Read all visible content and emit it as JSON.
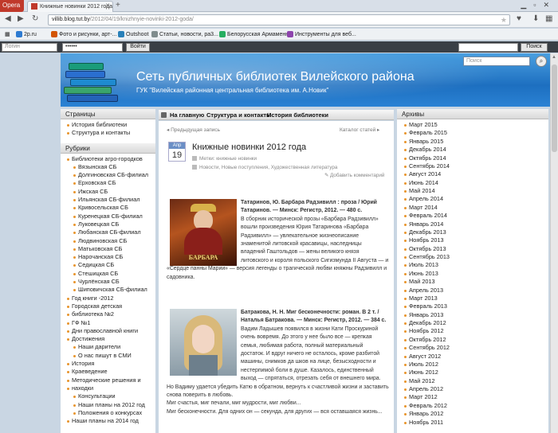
{
  "browser": {
    "app": "Opera",
    "tab_title": "Книжные новинки 2012 года",
    "url_prefix": "villib.blog.tut.by",
    "url_path": "/2012/04/19/knizhnyie-novinki-2012-goda/"
  },
  "bookmarks": [
    {
      "label": "2p.ru",
      "color": "#2e7bd1"
    },
    {
      "label": "Фото и рисунки, арт-...",
      "color": "#d35400"
    },
    {
      "label": "Outshoot",
      "color": "#2980b9"
    },
    {
      "label": "Статьи, новости, ра3...",
      "color": "#7f8c8d"
    },
    {
      "label": "Белорусская Армаменн...",
      "color": "#27ae60"
    },
    {
      "label": "Инструменты для веб...",
      "color": "#8e44ad"
    }
  ],
  "login": {
    "user_placeholder": "Логин",
    "password_value": "••••••",
    "login_button": "Войти",
    "search_button": "Поиск"
  },
  "header": {
    "title": "Сеть публичных библиотек Вилейского района",
    "subtitle": "ГУК \"Вилейская районная центральная библиотека им. А.Новик\"",
    "search_placeholder": "Поиск"
  },
  "left": {
    "pages_title": "Страницы",
    "pages": [
      "История библиотеки",
      "Структура и контакты"
    ],
    "rubrics_title": "Рубрики",
    "rubrics": [
      {
        "t": "Библиотеки агро-городков",
        "s": false
      },
      {
        "t": "Вязынская СБ",
        "s": true
      },
      {
        "t": "Долгиновская СБ-филиал",
        "s": true
      },
      {
        "t": "Ерховская СБ",
        "s": true
      },
      {
        "t": "Ижская СБ",
        "s": true
      },
      {
        "t": "Ильянская СБ-филиал",
        "s": true
      },
      {
        "t": "Кривосельская СБ",
        "s": true
      },
      {
        "t": "Куренецкая СБ-филиал",
        "s": true
      },
      {
        "t": "Луковецкая СБ",
        "s": true
      },
      {
        "t": "Любанская СБ-филиал",
        "s": true
      },
      {
        "t": "Людвиновская СБ",
        "s": true
      },
      {
        "t": "Матьковская СБ",
        "s": true
      },
      {
        "t": "Нарочанская СБ",
        "s": true
      },
      {
        "t": "Седицкая СБ",
        "s": true
      },
      {
        "t": "Стешицкая СБ",
        "s": true
      },
      {
        "t": "Чурлёнская СБ",
        "s": true
      },
      {
        "t": "Шиповичская СБ-филиал",
        "s": true
      },
      {
        "t": "Год книги -2012",
        "s": false
      },
      {
        "t": "Городская детская",
        "s": false
      },
      {
        "t": "библиотека №2",
        "s": false
      },
      {
        "t": "ГФ №1",
        "s": false
      },
      {
        "t": "Дни православной книги",
        "s": false
      },
      {
        "t": "Достижения",
        "s": false
      },
      {
        "t": "Наши дарители",
        "s": true
      },
      {
        "t": "О нас пишут в СМИ",
        "s": true
      },
      {
        "t": "История",
        "s": false
      },
      {
        "t": "Краеведение",
        "s": false
      },
      {
        "t": "Методические решения и",
        "s": false
      },
      {
        "t": "находки",
        "s": false
      },
      {
        "t": "Консультации",
        "s": true
      },
      {
        "t": "Наши планы на 2012 год",
        "s": true
      },
      {
        "t": "Положения о конкурсах",
        "s": true
      },
      {
        "t": "Наши планы на 2014 год",
        "s": false
      }
    ]
  },
  "menu": [
    "На главную",
    "Структура и контакты",
    "История библиотеки"
  ],
  "post": {
    "prev": "Предыдущая запись",
    "next": "Каталог статей",
    "month": "Апр",
    "day": "19",
    "title": "Книжные новинки 2012 года",
    "tags": "Метки: книжные новинки",
    "cats": "Новости, Новые поступления, Художественная литература",
    "add_comment": "Добавить комментарий",
    "book1_caption": "БАРБАРА",
    "book1": [
      "Татаринов, Ю. Барбара Радзивилл : проза / Юрий",
      "Татаринов. — Минск: Регистр, 2012. — 480 с.",
      "В сборник исторической прозы «Барбара Радзивилл»",
      "вошли произведения Юрия Татаринова «Барбара",
      "Радзивилл» — увлекательное жизнеописание",
      "знаменитой литовской красавицы, наследницы",
      "владений Гаштольдов — жены великого князя",
      "литовского и короля польского Сигизмунда II Августа — и",
      "«Сердце панны Марии» — версия легенды о трагической любви княжны Радзивилл и",
      "садовника."
    ],
    "book2": [
      "Батракова, Н. Н. Миг бесконечности: роман. В 2 т. /",
      "Наталья Батракова. — Минск: Регистр, 2012. — 384 с.",
      "Вадим Ладышев появился в жизни Кати Проскуриной",
      "очень вовремя. До этого у нее было все — крепкая",
      "семья, любимая работа, полный материальный",
      "достаток. И вдруг ничего не осталось, кроме разбитой",
      "машины, снимков да шков на лице, безысходности и",
      "нестерпимой боли в душе. Казалось, единственный",
      "выход — спрятаться, отрезать себя от внешнего мира.",
      "Но Вадиму удается убедить Катю в обратном, вернуть к счастливой жизни и заставить",
      "снова поверить в любовь.",
      "Миг счастья, миг печали, миг мудрости, миг любви...",
      "Миг бесконечности. Для одних он — секунда, для других — вся оставшаяся жизнь..."
    ]
  },
  "archive": {
    "title": "Архивы",
    "items": [
      "Март 2015",
      "Февраль 2015",
      "Январь 2015",
      "Декабрь 2014",
      "Октябрь 2014",
      "Сентябрь 2014",
      "Август 2014",
      "Июнь 2014",
      "Май 2014",
      "Апрель 2014",
      "Март 2014",
      "Февраль 2014",
      "Январь 2014",
      "Декабрь 2013",
      "Ноябрь 2013",
      "Октябрь 2013",
      "Сентябрь 2013",
      "Июль 2013",
      "Июнь 2013",
      "Май 2013",
      "Апрель 2013",
      "Март 2013",
      "Февраль 2013",
      "Январь 2013",
      "Декабрь 2012",
      "Ноябрь 2012",
      "Октябрь 2012",
      "Сентябрь 2012",
      "Август 2012",
      "Июль 2012",
      "Июнь 2012",
      "Май 2012",
      "Апрель 2012",
      "Март 2012",
      "Февраль 2012",
      "Январь 2012",
      "Ноябрь 2011"
    ]
  }
}
